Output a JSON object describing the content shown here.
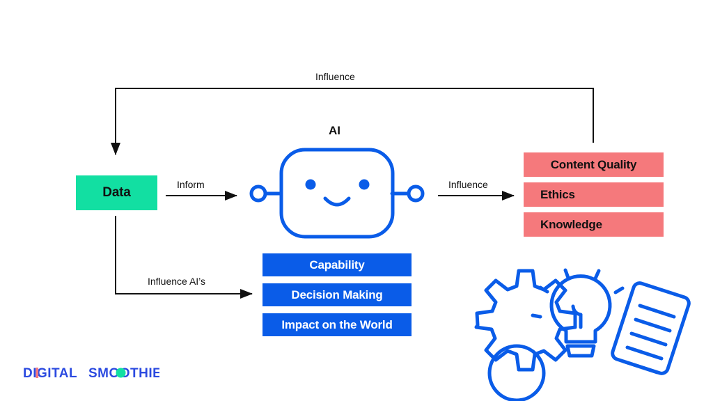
{
  "diagram": {
    "title": "AI influence flow diagram",
    "background_color": "#ffffff",
    "nodes": {
      "data": {
        "label": "Data",
        "color": "#12dfa2"
      },
      "ai": {
        "label": "AI",
        "color": "#0a5ce8",
        "icon": "robot-head-icon"
      }
    },
    "outcomes": {
      "color": "#f5797c",
      "items": [
        {
          "label": "Content Quality",
          "align": "center"
        },
        {
          "label": "Ethics",
          "align": "left"
        },
        {
          "label": "Knowledge",
          "align": "left"
        }
      ]
    },
    "aspects": {
      "color": "#0a5ce8",
      "items": [
        {
          "label": "Capability"
        },
        {
          "label": "Decision Making"
        },
        {
          "label": "Impact on the World"
        }
      ]
    },
    "edges": [
      {
        "id": "influence-top",
        "label": "Influence"
      },
      {
        "id": "inform",
        "label": "Inform"
      },
      {
        "id": "influence-right",
        "label": "Influence"
      },
      {
        "id": "influence-ais",
        "label": "Influence AI’s"
      }
    ],
    "decorations": [
      {
        "name": "gear-icon",
        "color": "#0a5ce8"
      },
      {
        "name": "lightbulb-icon",
        "color": "#0a5ce8"
      },
      {
        "name": "document-icon",
        "color": "#0a5ce8"
      }
    ]
  },
  "logo": {
    "text_primary": "DIGITAL",
    "text_secondary": "SMOOTHIE",
    "full_text": "DIGITAL SMOOTHIE",
    "color_blue": "#2b4ae0",
    "color_accent_red": "#f5797c",
    "color_accent_green": "#12dfa2"
  }
}
